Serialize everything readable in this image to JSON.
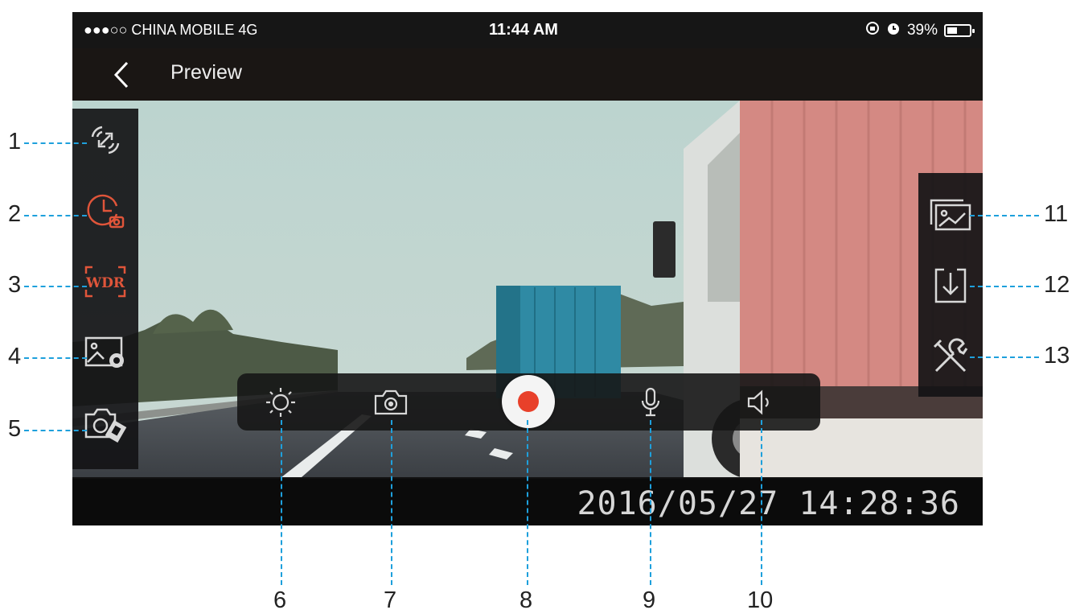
{
  "status_bar": {
    "carrier": "●●●○○ CHINA MOBILE  4G",
    "time": "11:44 AM",
    "battery": "39%",
    "battery_level_percent": 39
  },
  "nav": {
    "back_icon": "chevron-left-icon",
    "title": "Preview"
  },
  "left_toolbar": [
    {
      "icon": "wifi-sync-icon",
      "callout": "1"
    },
    {
      "icon": "timelapse-clock-icon",
      "callout": "2"
    },
    {
      "icon": "wdr-icon",
      "label": "WDR",
      "callout": "3"
    },
    {
      "icon": "image-settings-icon",
      "callout": "4"
    },
    {
      "icon": "camera-video-mode-icon",
      "callout": "5"
    }
  ],
  "bottom_toolbar": [
    {
      "icon": "brightness-icon",
      "callout": "6"
    },
    {
      "icon": "snapshot-camera-icon",
      "callout": "7"
    },
    {
      "icon": "record-icon",
      "callout": "8"
    },
    {
      "icon": "microphone-icon",
      "callout": "9"
    },
    {
      "icon": "speaker-icon",
      "callout": "10"
    }
  ],
  "right_toolbar": [
    {
      "icon": "gallery-icon",
      "callout": "11"
    },
    {
      "icon": "download-icon",
      "callout": "12"
    },
    {
      "icon": "tools-settings-icon",
      "callout": "13"
    }
  ],
  "video_timestamp": "2016/05/27  14:28:36",
  "colors": {
    "accent_orange": "#e0553a",
    "record_red": "#e8402a",
    "callout_line": "#1ea0dc",
    "icon_grey": "#d8d8d8"
  }
}
